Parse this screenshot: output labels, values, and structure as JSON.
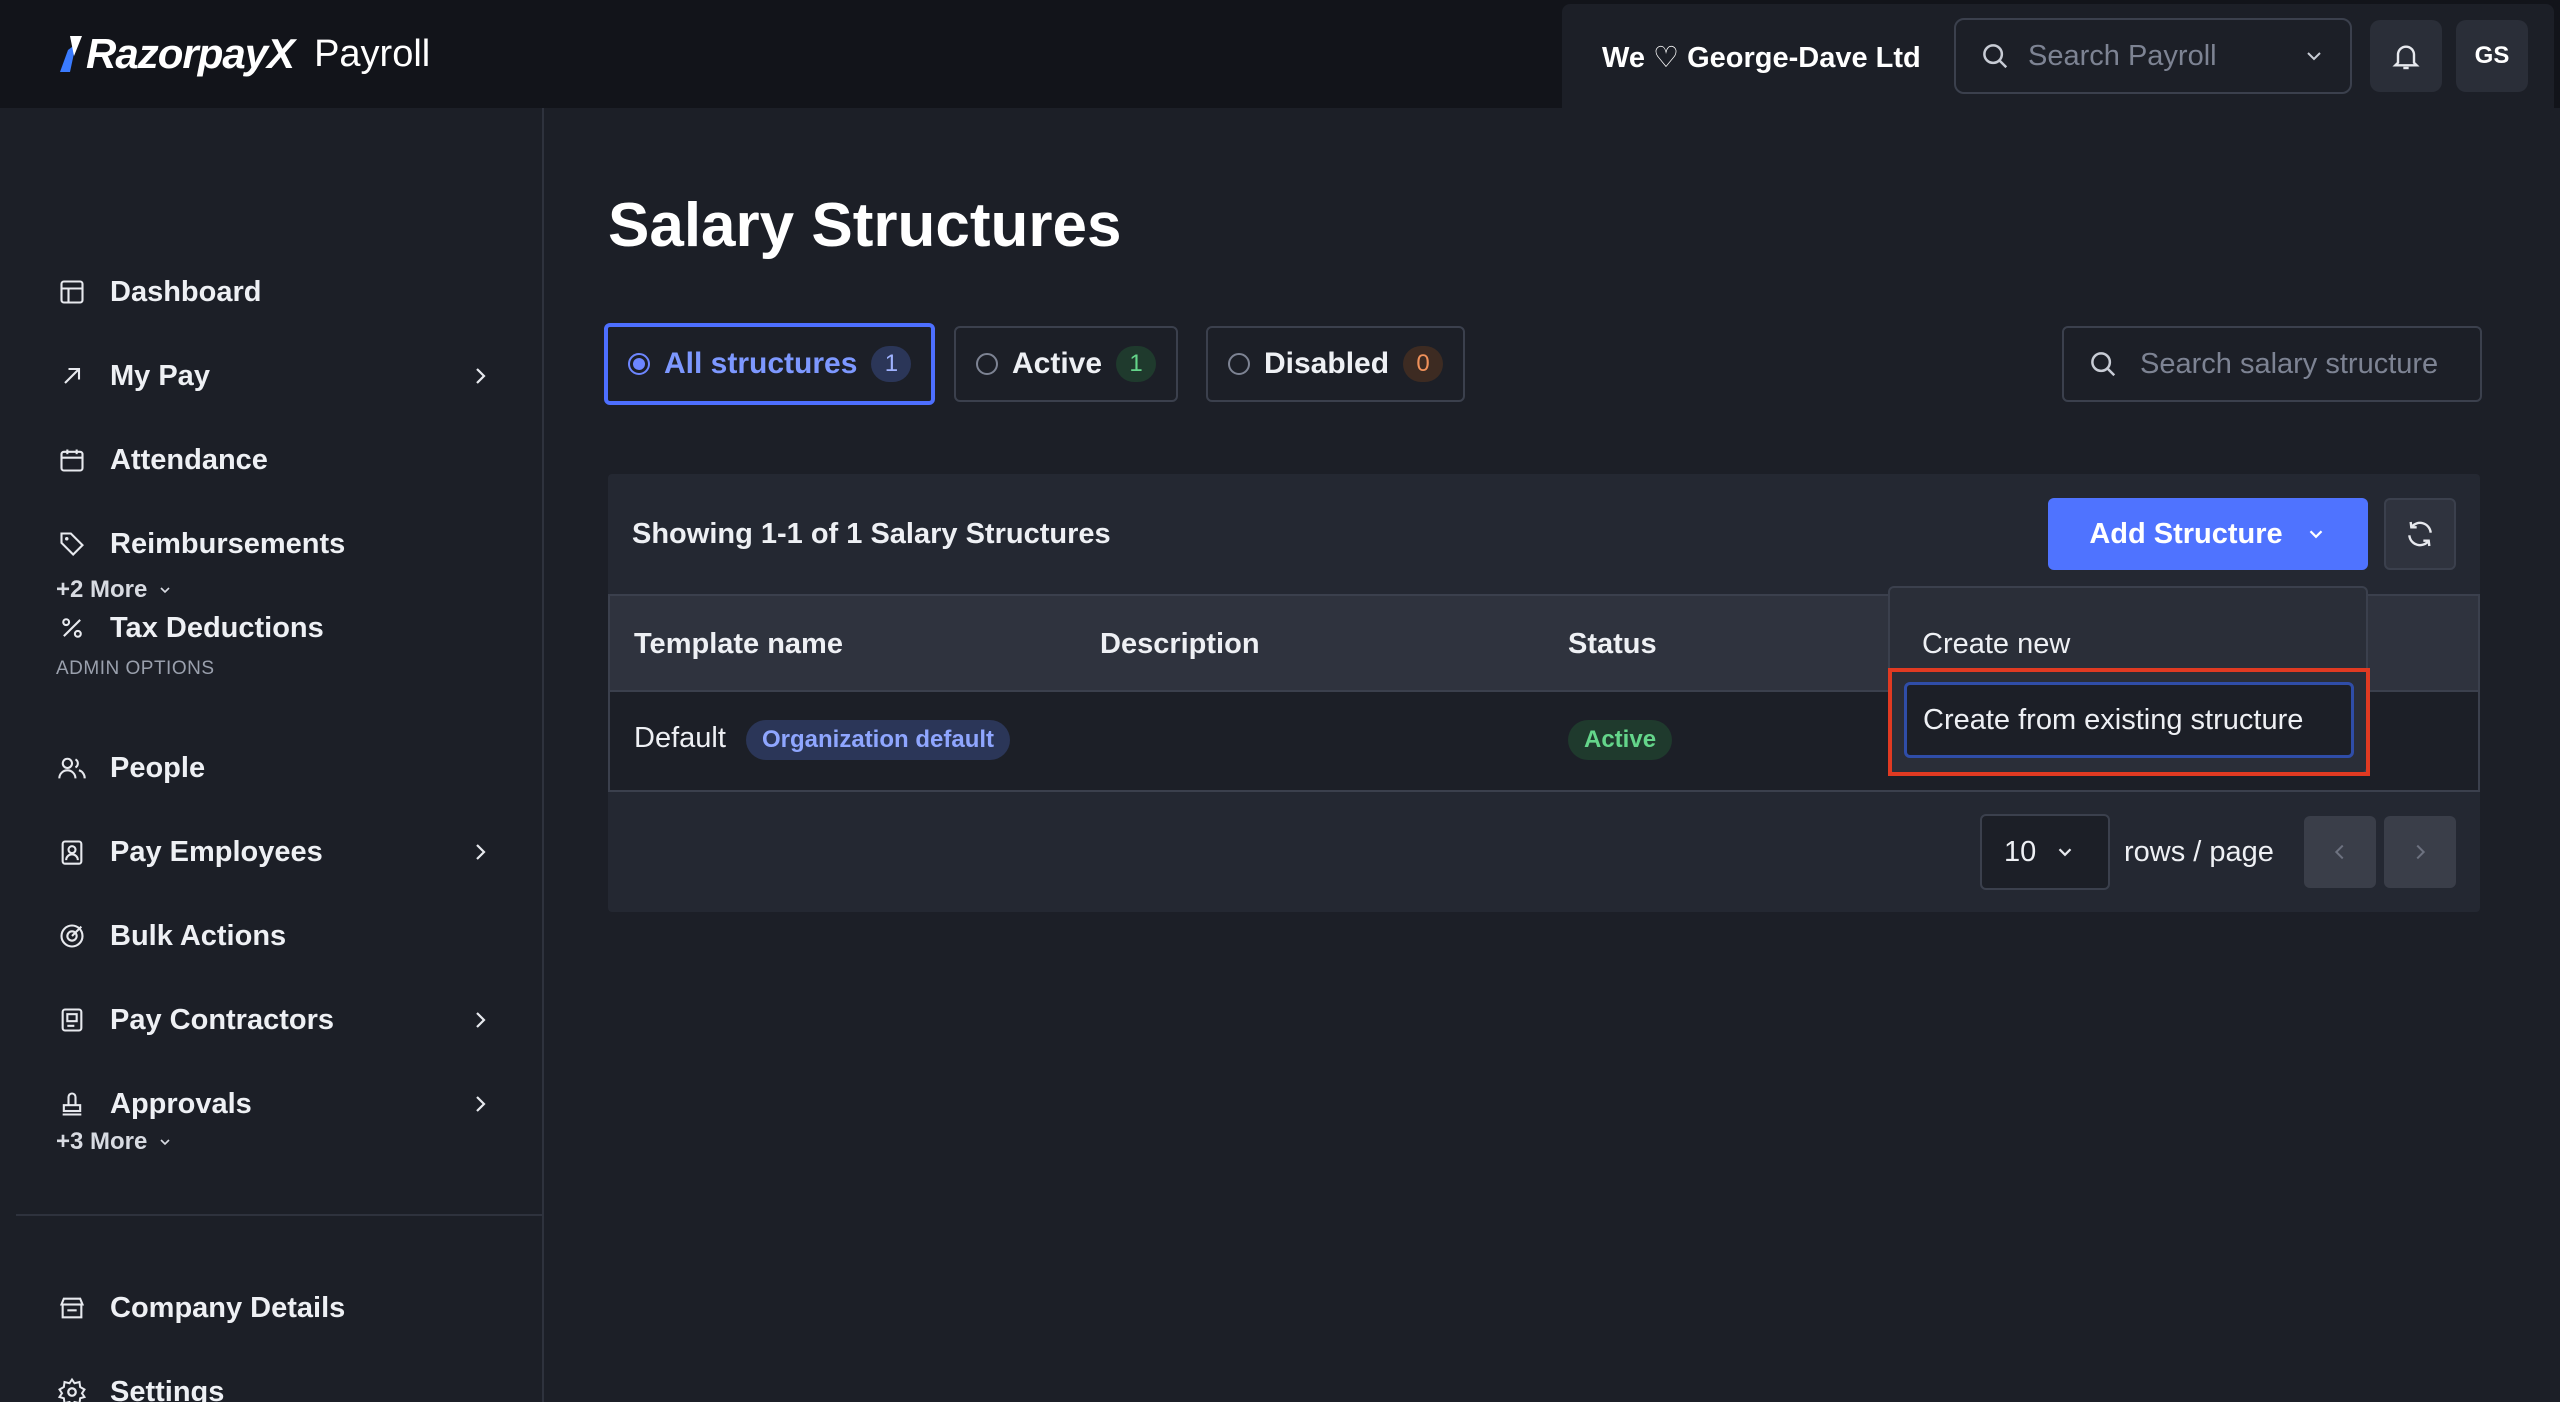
{
  "header": {
    "brand_name": "RazorpayX",
    "product": "Payroll",
    "company": "We ♡ George-Dave Ltd",
    "search_placeholder": "Search Payroll",
    "avatar_initials": "GS"
  },
  "sidebar": {
    "items": [
      {
        "label": "Dashboard",
        "icon": "layout-icon"
      },
      {
        "label": "My Pay",
        "icon": "arrow-up-right-icon"
      },
      {
        "label": "Attendance",
        "icon": "calendar-icon"
      },
      {
        "label": "Reimbursements",
        "icon": "tag-icon"
      },
      {
        "label": "Tax Deductions",
        "icon": "percent-icon"
      }
    ],
    "more1": "+2 More",
    "admin_label": "ADMIN OPTIONS",
    "admin_items": [
      {
        "label": "People",
        "icon": "users-icon"
      },
      {
        "label": "Pay Employees",
        "icon": "id-badge-icon"
      },
      {
        "label": "Bulk Actions",
        "icon": "target-icon"
      },
      {
        "label": "Pay Contractors",
        "icon": "contractor-icon"
      },
      {
        "label": "Approvals",
        "icon": "stamp-icon"
      }
    ],
    "more2": "+3 More",
    "bottom_items": [
      {
        "label": "Company Details",
        "icon": "store-icon"
      },
      {
        "label": "Settings",
        "icon": "gear-icon"
      }
    ]
  },
  "main": {
    "title": "Salary Structures",
    "filters": [
      {
        "label": "All structures",
        "count": "1",
        "selected": true
      },
      {
        "label": "Active",
        "count": "1"
      },
      {
        "label": "Disabled",
        "count": "0"
      }
    ],
    "search_placeholder": "Search salary structure",
    "showing": "Showing 1-1 of 1 Salary Structures",
    "add_button": "Add Structure",
    "columns": [
      "Template name",
      "Description",
      "Status"
    ],
    "rows": [
      {
        "name": "Default",
        "badge": "Organization default",
        "description": "",
        "status": "Active"
      }
    ],
    "rows_per_page": "10",
    "rows_label": "rows / page"
  },
  "dropdown": {
    "items": [
      "Create new",
      "Create from existing structure"
    ]
  },
  "colors": {
    "accent": "#4f73ff",
    "highlight_outline": "#e03a22",
    "success": "#64d58a"
  }
}
